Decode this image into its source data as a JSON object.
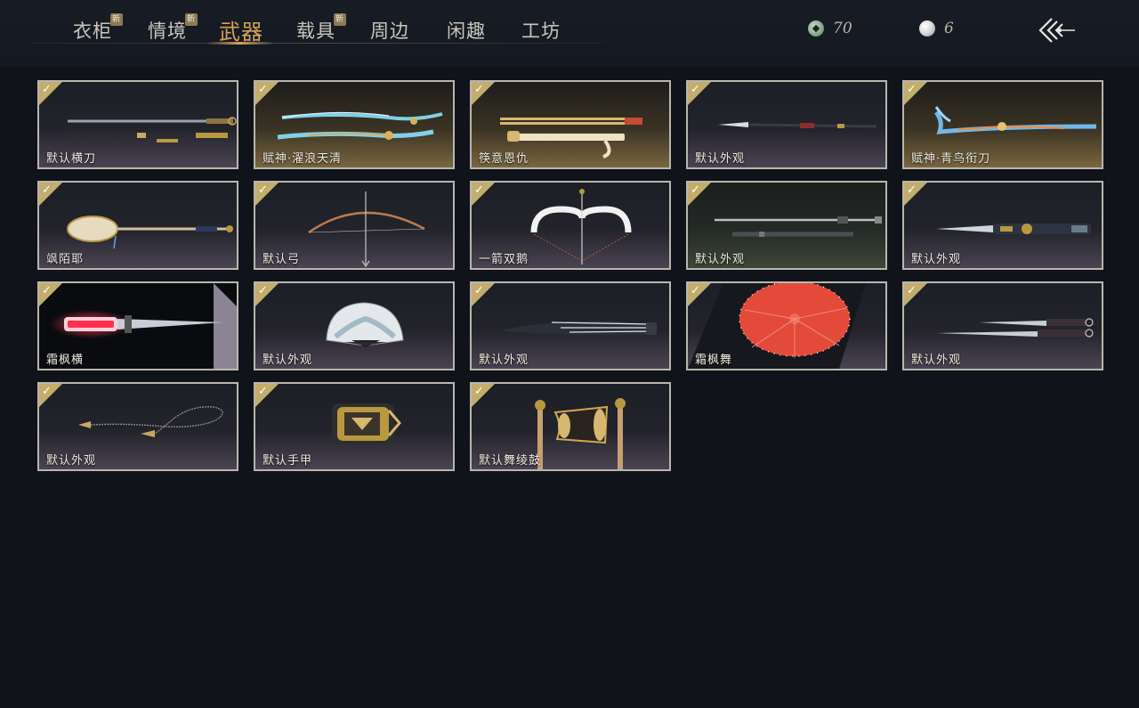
{
  "tabs": [
    {
      "label": "衣柜",
      "badge": "新"
    },
    {
      "label": "情境",
      "badge": "新"
    },
    {
      "label": "武器",
      "badge": ""
    },
    {
      "label": "载具",
      "badge": "新"
    },
    {
      "label": "周边",
      "badge": ""
    },
    {
      "label": "闲趣",
      "badge": ""
    },
    {
      "label": "工坊",
      "badge": ""
    }
  ],
  "active_tab": "武器",
  "currency": {
    "jade": "70",
    "pearl": "6"
  },
  "colors": {
    "accent": "#d6a35a",
    "check": "#c3ad6d",
    "background": "#10131a"
  },
  "items": [
    {
      "label": "默认横刀",
      "icon": "sword-icon"
    },
    {
      "label": "赋神·濯浪天清",
      "icon": "glowing-blade-icon"
    },
    {
      "label": "筷意恩仇",
      "icon": "chopsticks-icon"
    },
    {
      "label": "默认外观",
      "icon": "spear-icon"
    },
    {
      "label": "赋神·青鸟衔刀",
      "icon": "glowing-blade-icon"
    },
    {
      "label": "飒陌耶",
      "icon": "pipa-icon"
    },
    {
      "label": "默认弓",
      "icon": "bow-icon"
    },
    {
      "label": "一箭双鹅",
      "icon": "goose-bow-icon"
    },
    {
      "label": "默认外观",
      "icon": "twin-spear-icon"
    },
    {
      "label": "默认外观",
      "icon": "ornate-sword-icon"
    },
    {
      "label": "霜枫横",
      "icon": "red-glow-blade-icon"
    },
    {
      "label": "默认外观",
      "icon": "fan-icon"
    },
    {
      "label": "默认外观",
      "icon": "closed-umbrella-icon"
    },
    {
      "label": "霜枫舞",
      "icon": "red-umbrella-icon"
    },
    {
      "label": "默认外观",
      "icon": "twin-swords-icon"
    },
    {
      "label": "默认外观",
      "icon": "rope-dart-icon"
    },
    {
      "label": "默认手甲",
      "icon": "gauntlet-icon"
    },
    {
      "label": "默认舞绫鼓",
      "icon": "drum-icon"
    }
  ]
}
